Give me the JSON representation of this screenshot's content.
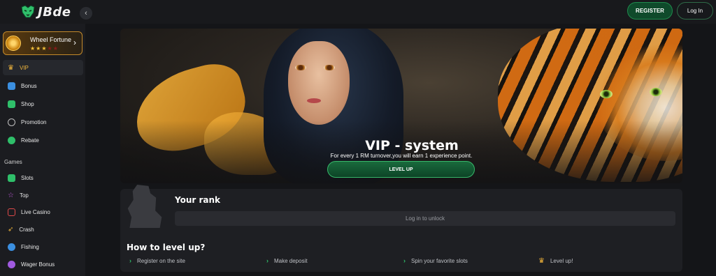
{
  "header": {
    "logo_text": "JBde",
    "collapse_icon": "chevron-left-icon",
    "register_label": "REGISTER",
    "login_label": "Log In"
  },
  "sidebar": {
    "wheel": {
      "title": "Wheel Fortune",
      "stars_filled": 3,
      "stars_total": 5
    },
    "items": [
      {
        "label": "VIP",
        "icon": "crown-icon",
        "color": "#f0b63c",
        "active": true
      },
      {
        "label": "Bonus",
        "icon": "gift-icon",
        "color": "#3b8fe0",
        "active": false
      },
      {
        "label": "Shop",
        "icon": "shop-icon",
        "color": "#2fbf6a",
        "active": false
      },
      {
        "label": "Promotion",
        "icon": "compass-icon",
        "color": "#bfbfbf",
        "active": false
      },
      {
        "label": "Rebate",
        "icon": "rebate-icon",
        "color": "#2fbf6a",
        "active": false
      }
    ],
    "games_label": "Games",
    "games": [
      {
        "label": "Slots",
        "icon": "slots-icon",
        "color": "#2fbf6a"
      },
      {
        "label": "Top",
        "icon": "star-icon",
        "color": "#c25ae0"
      },
      {
        "label": "Live Casino",
        "icon": "live-casino-icon",
        "color": "#e04a4a"
      },
      {
        "label": "Crash",
        "icon": "rocket-icon",
        "color": "#f0b63c"
      },
      {
        "label": "Fishing",
        "icon": "fish-icon",
        "color": "#3b8fe0"
      },
      {
        "label": "Wager Bonus",
        "icon": "wager-icon",
        "color": "#a05ae0"
      }
    ]
  },
  "banner": {
    "title": "VIP - system",
    "subtitle": "For every 1 RM turnover,you will earn 1 experience point.",
    "button_label": "LEVEL UP"
  },
  "rank": {
    "title": "Your rank",
    "unlock_text": "Log in to unlock",
    "howto_title": "How to level up?",
    "steps": [
      "Register on the site",
      "Make deposit",
      "Spin your favorite slots",
      "Level up!"
    ]
  },
  "colors": {
    "accent_green": "#1f8a4d",
    "gold": "#f0b63c",
    "background": "#141518"
  }
}
